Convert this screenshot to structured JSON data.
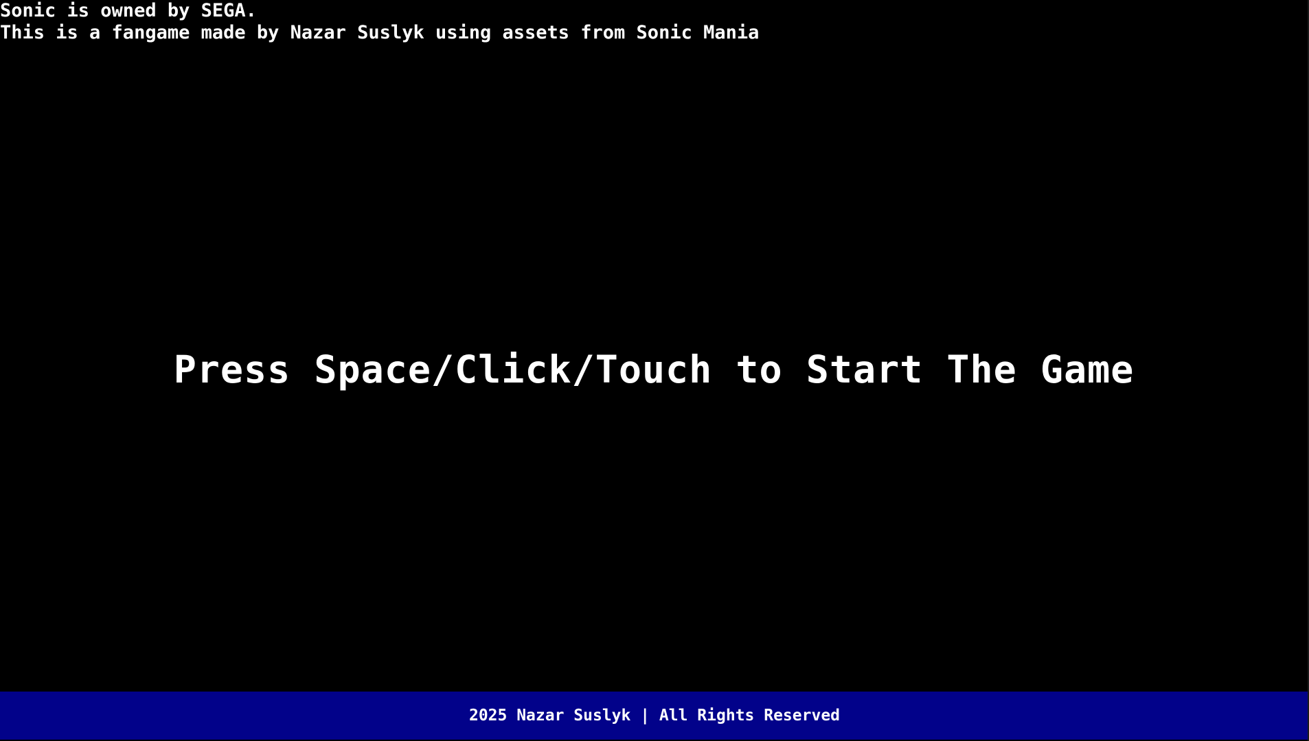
{
  "credits": {
    "line1": "Sonic is owned by SEGA.",
    "line2": "This is a fangame made by Nazar Suslyk using assets from Sonic Mania"
  },
  "main": {
    "start_prompt": "Press Space/Click/Touch to Start The Game"
  },
  "footer": {
    "text": "2025 Nazar Suslyk | All Rights Reserved"
  },
  "colors": {
    "background": "#000000",
    "text": "#ffffff",
    "footer_background": "#02028a"
  }
}
